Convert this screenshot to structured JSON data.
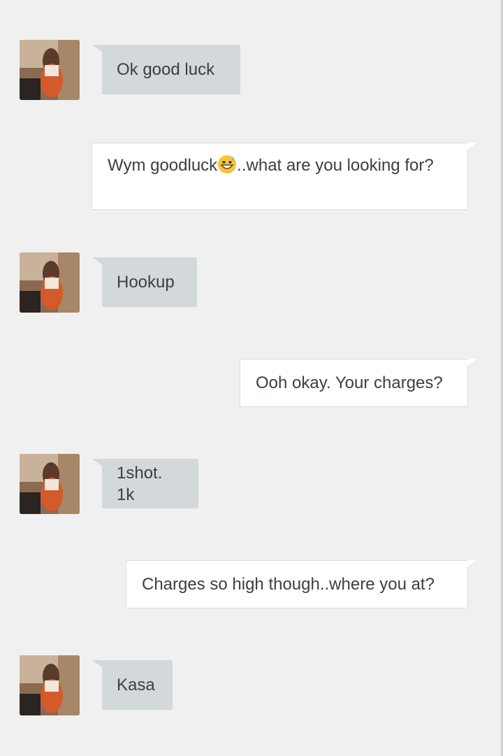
{
  "messages": [
    {
      "from": "them",
      "text": "Ok good luck",
      "avatar": "profile-photo"
    },
    {
      "from": "me",
      "text_before": "Wym goodluck",
      "emoji": "grinning-face-with-sweat",
      "text_after": "..what are you looking for?"
    },
    {
      "from": "them",
      "text": "Hookup",
      "avatar": "profile-photo"
    },
    {
      "from": "me",
      "text": "Ooh okay. Your charges?"
    },
    {
      "from": "them",
      "text": "1shot. 1k",
      "avatar": "profile-photo"
    },
    {
      "from": "me",
      "text": "Charges so high though..where you at?"
    },
    {
      "from": "them",
      "text": "Kasa",
      "avatar": "profile-photo"
    }
  ],
  "colors": {
    "background": "#f0f0f0",
    "incoming_bubble": "#d3d8da",
    "outgoing_bubble": "#ffffff",
    "text": "#3a3f44"
  }
}
